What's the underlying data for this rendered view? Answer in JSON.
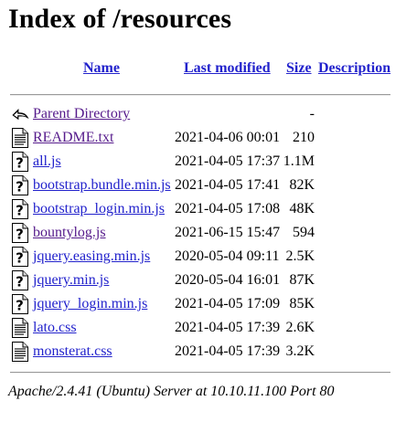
{
  "page": {
    "title": "Index of /resources"
  },
  "columns": {
    "name": "Name",
    "last_modified": "Last modified",
    "size": "Size",
    "description": "Description"
  },
  "entries": [
    {
      "icon": "back-icon",
      "name": "Parent Directory",
      "date": "",
      "size": "-",
      "visited": true
    },
    {
      "icon": "text-file-icon",
      "name": "README.txt",
      "date": "2021-04-06 00:01",
      "size": "210",
      "visited": true
    },
    {
      "icon": "unknown-file-icon",
      "name": "all.js",
      "date": "2021-04-05 17:37",
      "size": "1.1M",
      "visited": false
    },
    {
      "icon": "unknown-file-icon",
      "name": "bootstrap.bundle.min.js",
      "date": "2021-04-05 17:41",
      "size": "82K",
      "visited": false
    },
    {
      "icon": "unknown-file-icon",
      "name": "bootstrap_login.min.js",
      "date": "2021-04-05 17:08",
      "size": "48K",
      "visited": false
    },
    {
      "icon": "unknown-file-icon",
      "name": "bountylog.js",
      "date": "2021-06-15 15:47",
      "size": "594",
      "visited": true
    },
    {
      "icon": "unknown-file-icon",
      "name": "jquery.easing.min.js",
      "date": "2020-05-04 09:11",
      "size": "2.5K",
      "visited": false
    },
    {
      "icon": "unknown-file-icon",
      "name": "jquery.min.js",
      "date": "2020-05-04 16:01",
      "size": "87K",
      "visited": false
    },
    {
      "icon": "unknown-file-icon",
      "name": "jquery_login.min.js",
      "date": "2021-04-05 17:09",
      "size": "85K",
      "visited": false
    },
    {
      "icon": "text-file-icon",
      "name": "lato.css",
      "date": "2021-04-05 17:39",
      "size": "2.6K",
      "visited": false
    },
    {
      "icon": "text-file-icon",
      "name": "monsterat.css",
      "date": "2021-04-05 17:39",
      "size": "3.2K",
      "visited": false
    }
  ],
  "footer": {
    "text": "Apache/2.4.41 (Ubuntu) Server at 10.10.11.100 Port 80"
  },
  "colors": {
    "link": "#2222cc",
    "visited": "#551a8b"
  }
}
